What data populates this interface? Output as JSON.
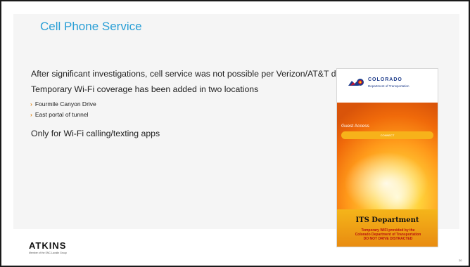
{
  "slide": {
    "title": "Cell Phone Service",
    "line1": "After significant investigations, cell service was not possible per Verizon/AT&T due to terrain",
    "line2": "Temporary Wi-Fi coverage has been added in two locations",
    "sub_items": [
      "Fourmile Canyon Drive",
      "East portal of tunnel"
    ],
    "line3": "Only for Wi-Fi calling/texting apps",
    "bullet_glyph": "›"
  },
  "phone": {
    "logo_word": "COLORADO",
    "logo_dept": "Department of Transportation",
    "guest_access": "Guest Access",
    "connect_label": "CONNECT",
    "its_title": "ITS Department",
    "its_line1": "Temporary WIFI provided by the",
    "its_line2": "Colorado Department of Transportation",
    "its_line3": "DO NOT DRIVE DISTRACTED"
  },
  "footer": {
    "brand": "ATKINS",
    "brand_sub": "Member of the SNC-Lavalin Group",
    "page_number": "20"
  },
  "colors": {
    "title": "#2a9fd6",
    "chevron": "#e08a1e",
    "its_sub": "#b8100e"
  }
}
